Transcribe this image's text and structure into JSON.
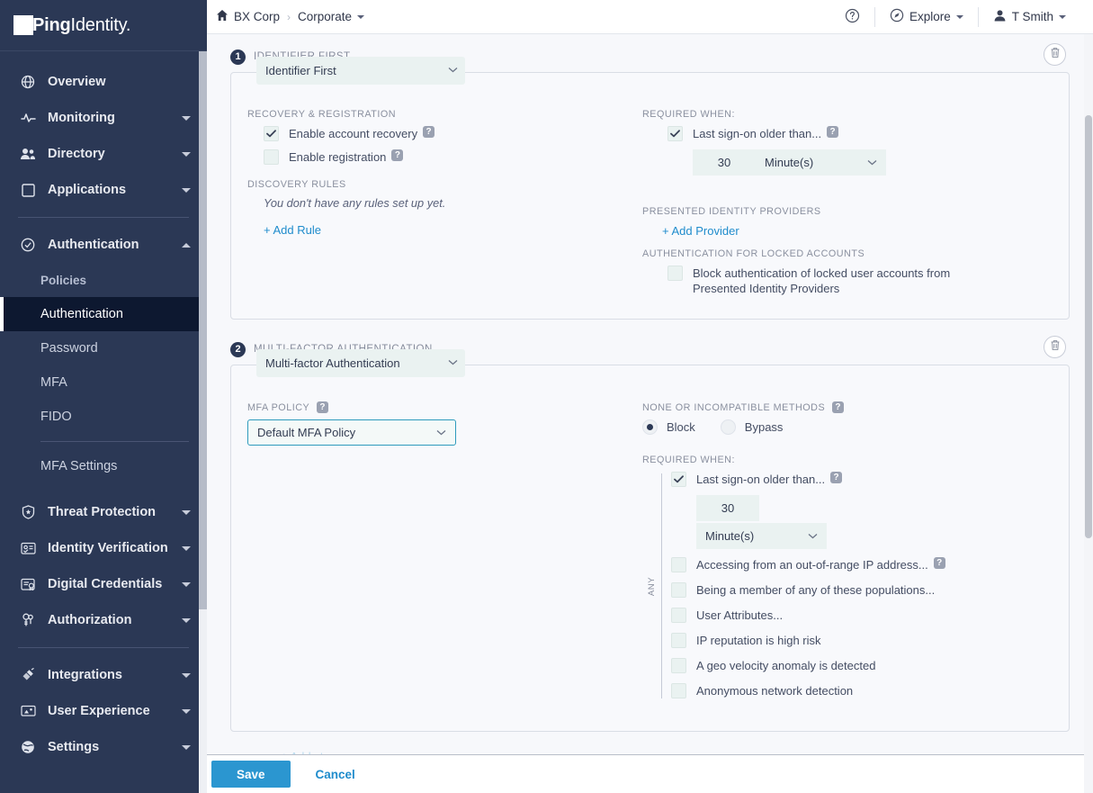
{
  "sidebar": {
    "logo": {
      "bold": "Ping",
      "light": "Identity."
    },
    "items": [
      {
        "label": "Overview",
        "icon": "globe-icon",
        "expandable": false
      },
      {
        "label": "Monitoring",
        "icon": "activity-icon",
        "expandable": true
      },
      {
        "label": "Directory",
        "icon": "people-icon",
        "expandable": true
      },
      {
        "label": "Applications",
        "icon": "square-icon",
        "expandable": true
      }
    ],
    "auth_section": {
      "label": "Authentication",
      "icon": "check-circle-icon",
      "expanded": true,
      "sub_items": [
        {
          "label": "Policies",
          "active": false
        },
        {
          "label": "Authentication",
          "active": true
        },
        {
          "label": "Password",
          "active": false
        },
        {
          "label": "MFA",
          "active": false
        },
        {
          "label": "FIDO",
          "active": false
        }
      ],
      "settings_item": {
        "label": "MFA Settings"
      }
    },
    "items_lower": [
      {
        "label": "Threat Protection",
        "icon": "shield-star-icon",
        "expandable": true
      },
      {
        "label": "Identity Verification",
        "icon": "id-card-icon",
        "expandable": true
      },
      {
        "label": "Digital Credentials",
        "icon": "credential-icon",
        "expandable": true
      },
      {
        "label": "Authorization",
        "icon": "keys-icon",
        "expandable": true
      }
    ],
    "items_bottom": [
      {
        "label": "Integrations",
        "icon": "plug-icon",
        "expandable": true
      },
      {
        "label": "User Experience",
        "icon": "monitor-icon",
        "expandable": true
      },
      {
        "label": "Settings",
        "icon": "globe-settings-icon",
        "expandable": true
      }
    ]
  },
  "topbar": {
    "home_icon": "home-icon",
    "breadcrumb_org": "BX Corp",
    "breadcrumb_sep": "›",
    "breadcrumb_env": "Corporate",
    "help_icon": "help-circle-icon",
    "explore_label": "Explore",
    "explore_icon": "compass-icon",
    "user_label": "T Smith",
    "user_icon": "user-icon"
  },
  "steps": [
    {
      "number": "1",
      "title": "IDENTIFIER FIRST",
      "type_select": "Identifier First",
      "delete_icon": "trash-icon",
      "left": {
        "recovery_label": "RECOVERY & REGISTRATION",
        "checkboxes": [
          {
            "label": "Enable account recovery",
            "checked": true,
            "help": true
          },
          {
            "label": "Enable registration",
            "checked": false,
            "help": true
          }
        ],
        "discovery_label": "DISCOVERY RULES",
        "empty_text": "You don't have any rules set up yet.",
        "add_rule": "+ Add Rule"
      },
      "right": {
        "required_label": "REQUIRED WHEN:",
        "last_signon_label": "Last sign-on older than...",
        "last_signon_checked": true,
        "duration_value": "30",
        "duration_unit": "Minute(s)",
        "providers_label": "PRESENTED IDENTITY PROVIDERS",
        "add_provider": "Add Provider",
        "locked_label": "AUTHENTICATION FOR LOCKED ACCOUNTS",
        "locked_checkbox": "Block authentication of locked user accounts from Presented Identity Providers",
        "locked_checked": false
      }
    },
    {
      "number": "2",
      "title": "MULTI-FACTOR AUTHENTICATION",
      "type_select": "Multi-factor Authentication",
      "delete_icon": "trash-icon",
      "left": {
        "policy_label": "MFA POLICY",
        "policy_value": "Default MFA Policy"
      },
      "right": {
        "methods_label": "NONE OR INCOMPATIBLE METHODS",
        "radio_block": "Block",
        "radio_bypass": "Bypass",
        "radio_selected": "Block",
        "required_label": "REQUIRED WHEN:",
        "any_label": "ANY",
        "last_signon_label": "Last sign-on older than...",
        "last_signon_checked": true,
        "duration_value": "30",
        "duration_unit": "Minute(s)",
        "conditions": [
          {
            "label": "Accessing from an out-of-range IP address...",
            "checked": false,
            "help": true
          },
          {
            "label": "Being a member of any of these populations...",
            "checked": false,
            "help": false
          },
          {
            "label": "User Attributes...",
            "checked": false,
            "help": false
          },
          {
            "label": "IP reputation is high risk",
            "checked": false,
            "help": false
          },
          {
            "label": "A geo velocity anomaly is detected",
            "checked": false,
            "help": false
          },
          {
            "label": "Anonymous network detection",
            "checked": false,
            "help": false
          }
        ]
      }
    }
  ],
  "add_step_label": "+ Add step",
  "footer": {
    "save_label": "Save",
    "cancel_label": "Cancel"
  },
  "colors": {
    "sidebar_bg": "#2b3855",
    "active_item": "#0d1830",
    "accent_blue": "#2b96d0",
    "link_blue": "#1f8ccc",
    "field_bg": "#eaf2f1",
    "focus_border": "#2f9bbd"
  }
}
